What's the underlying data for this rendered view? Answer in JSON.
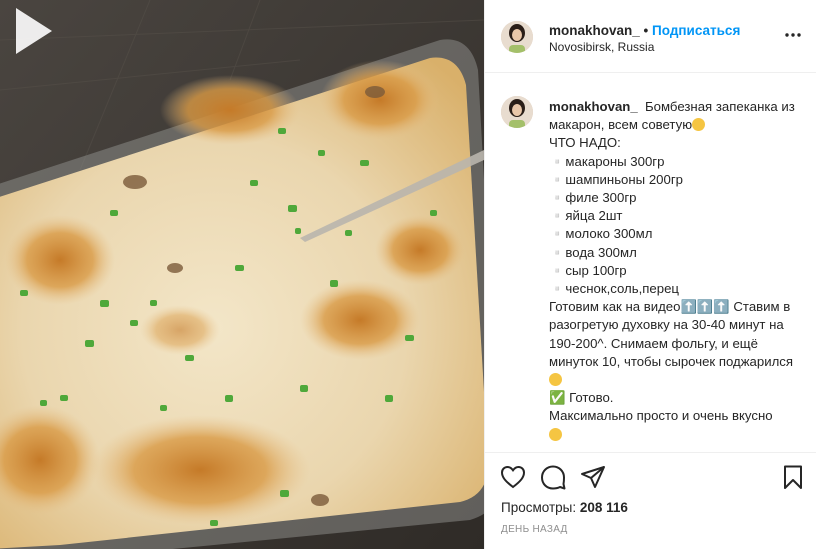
{
  "post": {
    "username": "monakhovan_",
    "separator": "•",
    "follow_label": "Подписаться",
    "location": "Novosibirsk, Russia",
    "more_icon": "more-horizontal-icon"
  },
  "caption": {
    "username": "monakhovan_",
    "line1": "Бомбезная запеканка из макарон, всем советую",
    "heading": "ЧТО НАДО:",
    "ingredients": [
      "▫️макароны 300гр",
      "▫️шампиньоны 200гр",
      "▫️филе 300гр",
      "▫️яйца 2шт",
      "▫️молоко 300мл",
      "▫️вода 300мл",
      "▫️сыр 100гр",
      "▫️чеснок,соль,перец"
    ],
    "body1": "Готовим как на видео⬆️⬆️⬆️ Ставим в разогретую духовку на 30-40 минут на 190-200^. Снимаем фольгу, и ещё минуток 10, чтобы сырочек поджарился",
    "body2": "✅ Готово.",
    "body3": "Максимально просто и очень вкусно"
  },
  "actions": {
    "like_icon": "heart-icon",
    "comment_icon": "comment-icon",
    "share_icon": "share-icon",
    "save_icon": "bookmark-icon"
  },
  "stats": {
    "views_label": "Просмотры:",
    "views_count": "208 116",
    "timestamp": "ДЕНЬ НАЗАД"
  },
  "media": {
    "play_icon": "play-icon"
  },
  "colors": {
    "follow": "#0095f6",
    "text": "#262626",
    "muted": "#8e8e8e"
  }
}
